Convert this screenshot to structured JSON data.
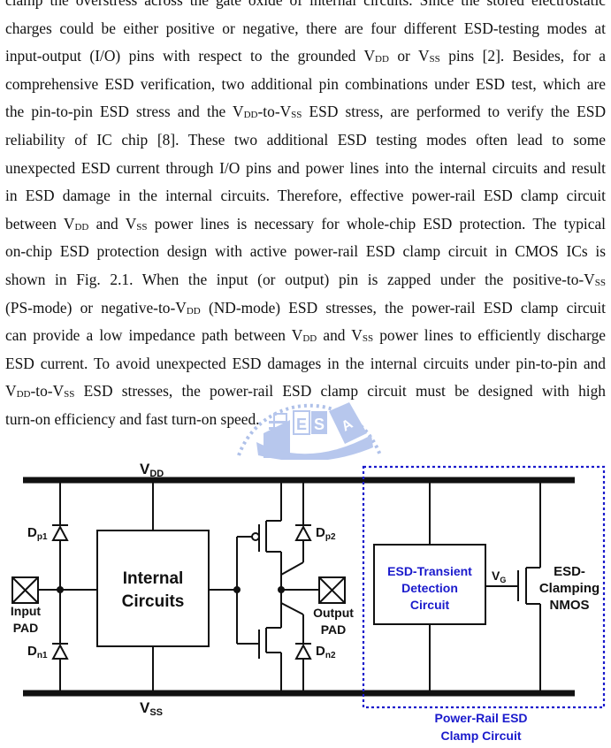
{
  "paragraph": {
    "lines": [
      [
        {
          "t": "clamp the overstress across the gate oxide of internal circuits. Since the stored electrostatic"
        }
      ],
      [
        {
          "t": "charges could be either positive or negative, there are four different ESD-testing modes at"
        }
      ],
      [
        {
          "t": "input-output (I/O) pins with respect to the grounded V"
        },
        {
          "s": "DD"
        },
        {
          "t": " or V"
        },
        {
          "s": "SS"
        },
        {
          "t": " pins [2]. Besides, for a"
        }
      ],
      [
        {
          "t": "comprehensive ESD verification, two additional pin combinations under ESD test, which are"
        }
      ],
      [
        {
          "t": "the pin-to-pin ESD stress and the V"
        },
        {
          "s": "DD"
        },
        {
          "t": "-to-V"
        },
        {
          "s": "SS"
        },
        {
          "t": " ESD stress, are performed to verify the ESD"
        }
      ],
      [
        {
          "t": "reliability of IC chip [8]. These two additional ESD testing modes often lead to some"
        }
      ],
      [
        {
          "t": "unexpected ESD current through I/O pins and power lines into the internal circuits and result"
        }
      ],
      [
        {
          "t": "in ESD damage in the internal circuits. Therefore, effective power-rail ESD clamp circuit"
        }
      ],
      [
        {
          "t": "between V"
        },
        {
          "s": "DD"
        },
        {
          "t": " and V"
        },
        {
          "s": "SS"
        },
        {
          "t": " power lines is necessary for whole-chip ESD protection. The typical"
        }
      ],
      [
        {
          "t": "on-chip ESD protection design with active power-rail ESD clamp circuit in CMOS ICs is"
        }
      ],
      [
        {
          "t": "shown in Fig. 2.1. When the input (or output) pin is zapped under the positive-to-V"
        },
        {
          "s": "SS"
        }
      ],
      [
        {
          "t": "(PS-mode) or negative-to-V"
        },
        {
          "s": "DD"
        },
        {
          "t": " (ND-mode) ESD stresses, the power-rail ESD clamp circuit"
        }
      ],
      [
        {
          "t": "can provide a low impedance path between V"
        },
        {
          "s": "DD"
        },
        {
          "t": " and V"
        },
        {
          "s": "SS"
        },
        {
          "t": " power lines to efficiently discharge"
        }
      ],
      [
        {
          "t": "ESD current. To avoid unexpected ESD damages in the internal circuits under pin-to-pin and"
        }
      ],
      [
        {
          "s": "DD",
          "pre": "V"
        },
        {
          "t": "-to-V"
        },
        {
          "s": "SS"
        },
        {
          "t": " ESD stresses, the power-rail ESD clamp circuit must be designed with high"
        }
      ],
      [
        {
          "t": "turn-on efficiency and fast turn-on speed."
        }
      ]
    ]
  },
  "watermark": {
    "letters": [
      "E",
      "S",
      "A"
    ]
  },
  "figure": {
    "vdd_label": "V",
    "vdd_sub": "DD",
    "vss_label": "V",
    "vss_sub": "SS",
    "dp1_label": "D",
    "dp1_sub": "p1",
    "dn1_label": "D",
    "dn1_sub": "n1",
    "dp2_label": "D",
    "dp2_sub": "p2",
    "dn2_label": "D",
    "dn2_sub": "n2",
    "input_pad_label": [
      "Input",
      "PAD"
    ],
    "output_pad_label": [
      "Output",
      "PAD"
    ],
    "internal_circuits_label": [
      "Internal",
      "Circuits"
    ],
    "esd_transient_label": [
      "ESD-Transient",
      "Detection",
      "Circuit"
    ],
    "vg_label": "V",
    "vg_sub": "G",
    "clamping_nmos_label": [
      "ESD-",
      "Clamping",
      "NMOS"
    ],
    "power_rail_label": [
      "Power-Rail ESD",
      "Clamp Circuit"
    ],
    "colors": {
      "line": "#111111",
      "accent": "#1a1acc"
    }
  }
}
